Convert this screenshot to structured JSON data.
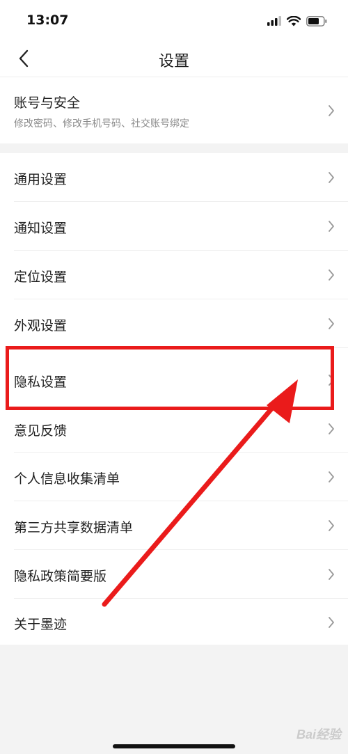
{
  "status_bar": {
    "time": "13:07",
    "icons": [
      "signal-icon",
      "wifi-icon",
      "battery-icon"
    ]
  },
  "nav": {
    "title": "设置",
    "back_icon": "chevron-left-icon"
  },
  "account_row": {
    "title": "账号与安全",
    "subtitle": "修改密码、修改手机号码、社交账号绑定"
  },
  "settings_items": [
    {
      "label": "通用设置"
    },
    {
      "label": "通知设置"
    },
    {
      "label": "定位设置"
    },
    {
      "label": "外观设置"
    },
    {
      "label": "隐私设置"
    },
    {
      "label": "意见反馈"
    },
    {
      "label": "个人信息收集清单"
    },
    {
      "label": "第三方共享数据清单"
    },
    {
      "label": "隐私政策简要版"
    },
    {
      "label": "关于墨迹"
    }
  ],
  "annotation": {
    "highlighted_item": "隐私设置",
    "color": "#ea1b1b"
  },
  "watermark": "Bai经验"
}
